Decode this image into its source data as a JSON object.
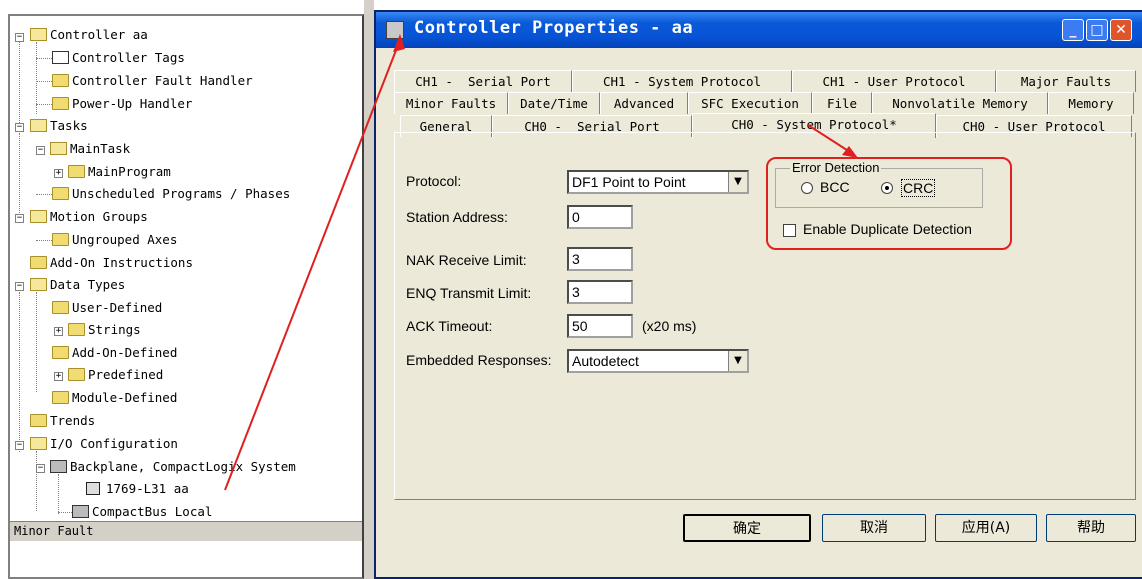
{
  "tree": {
    "items": [
      {
        "label": "Controller aa"
      },
      {
        "label": "Controller Tags"
      },
      {
        "label": "Controller Fault Handler"
      },
      {
        "label": "Power-Up Handler"
      },
      {
        "label": "Tasks"
      },
      {
        "label": "MainTask"
      },
      {
        "label": "MainProgram"
      },
      {
        "label": "Unscheduled Programs / Phases"
      },
      {
        "label": "Motion Groups"
      },
      {
        "label": "Ungrouped Axes"
      },
      {
        "label": "Add-On Instructions"
      },
      {
        "label": "Data Types"
      },
      {
        "label": "User-Defined"
      },
      {
        "label": "Strings"
      },
      {
        "label": "Add-On-Defined"
      },
      {
        "label": "Predefined"
      },
      {
        "label": "Module-Defined"
      },
      {
        "label": "Trends"
      },
      {
        "label": "I/O Configuration"
      },
      {
        "label": "Backplane, CompactLogix System"
      },
      {
        "label": "1769-L31 aa"
      },
      {
        "label": "CompactBus Local"
      }
    ],
    "status": "Minor Fault"
  },
  "dialog": {
    "title": "Controller Properties - aa",
    "tabs_row1": [
      "CH1 -  Serial Port",
      "CH1 - System Protocol",
      "CH1 - User Protocol",
      "Major Faults"
    ],
    "tabs_row2": [
      "Minor Faults",
      "Date/Time",
      "Advanced",
      "SFC Execution",
      "File",
      "Nonvolatile Memory",
      "Memory"
    ],
    "tabs_row3": [
      "General",
      "CH0 -  Serial Port",
      "CH0 - System Protocol*",
      "CH0 - User Protocol"
    ],
    "form": {
      "protocol_label": "Protocol:",
      "protocol_value": "DF1 Point to Point",
      "station_label": "Station Address:",
      "station_value": "0",
      "nak_label": "NAK Receive Limit:",
      "nak_value": "3",
      "enq_label": "ENQ Transmit Limit:",
      "enq_value": "3",
      "ack_label": "ACK Timeout:",
      "ack_value": "50",
      "ack_unit": "(x20 ms)",
      "embedded_label": "Embedded Responses:",
      "embedded_value": "Autodetect"
    },
    "error_detection": {
      "legend": "Error Detection",
      "bcc_label": "BCC",
      "crc_label": "CRC",
      "selected": "CRC",
      "duplicate_label": "Enable Duplicate Detection",
      "duplicate_checked": false
    },
    "buttons": {
      "ok": "确定",
      "cancel": "取消",
      "apply": "应用(A)",
      "help": "帮助"
    }
  },
  "colors": {
    "title_bar": "#0753d6",
    "annotation": "#e02020"
  }
}
